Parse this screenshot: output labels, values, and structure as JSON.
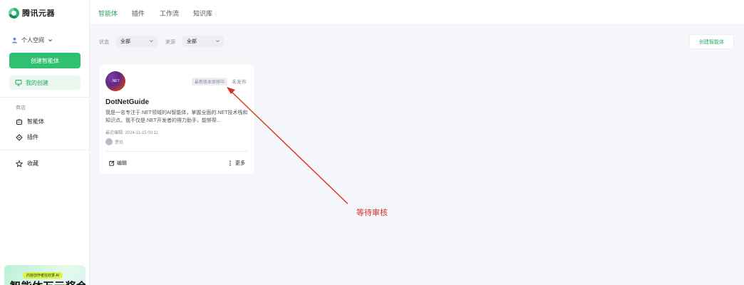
{
  "sidebar": {
    "brand": "腾讯元器",
    "space": "个人空间",
    "create_button": "创建智能体",
    "my_created": "我的创建",
    "store_label": "商店",
    "items": [
      {
        "label": "智能体",
        "icon": "robot-icon"
      },
      {
        "label": "插件",
        "icon": "plugin-icon"
      }
    ],
    "favorites": "收藏",
    "promo": {
      "tag": "内容创作者狂欢季 AI",
      "title": "智能体万元奖金"
    }
  },
  "topbar": {
    "tabs": [
      "智能体",
      "插件",
      "工作流",
      "知识库"
    ],
    "active_tab": "智能体"
  },
  "filters": {
    "status_label": "状态",
    "status_value": "全部",
    "source_label": "来源",
    "source_value": "全部"
  },
  "create_top_button": "创建智能体",
  "card": {
    "avatar_text": ".NET",
    "review_badge": "最新版本审核中",
    "status": "未发布",
    "title": "DotNetGuide",
    "description": "我是一名专注于.NET领域的AI智能体，掌握全面的.NET技术栈和知识点。我不仅是.NET开发者的得力助手，能够帮...",
    "last_edit": "最近编辑: 2024-11-15 00:11",
    "author": "贾玖",
    "edit_label": "编辑",
    "more_label": "更多"
  },
  "annotation": {
    "text": "等待审核",
    "color": "#d93025"
  },
  "colors": {
    "accent": "#2fc072",
    "accent_text": "#25a862"
  }
}
